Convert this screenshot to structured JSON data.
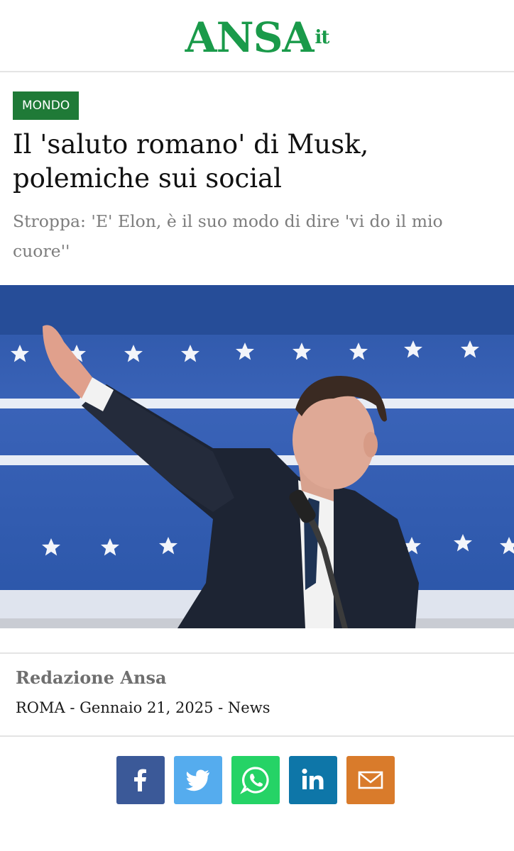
{
  "header": {
    "logo_main": "ANSA",
    "logo_sup": "it"
  },
  "article": {
    "category": "MONDO",
    "headline": "Il 'saluto romano' di Musk, polemiche sui social",
    "subtitle": "Stroppa: 'E' Elon, è il suo modo di dire 'vi do il mio cuore''",
    "author": "Redazione Ansa",
    "meta": "ROMA - Gennaio 21, 2025 - News"
  },
  "share": [
    {
      "name": "facebook",
      "icon": "facebook-icon",
      "color": "#3b5998"
    },
    {
      "name": "twitter",
      "icon": "twitter-icon",
      "color": "#55acee"
    },
    {
      "name": "whatsapp",
      "icon": "whatsapp-icon",
      "color": "#25d366"
    },
    {
      "name": "linkedin",
      "icon": "linkedin-icon",
      "color": "#0e76a8"
    },
    {
      "name": "email",
      "icon": "email-icon",
      "color": "#d97b2b"
    }
  ],
  "colors": {
    "brand": "#1a9a4a",
    "category_bg": "#1f7a37",
    "subtitle": "#7d7d7d"
  }
}
